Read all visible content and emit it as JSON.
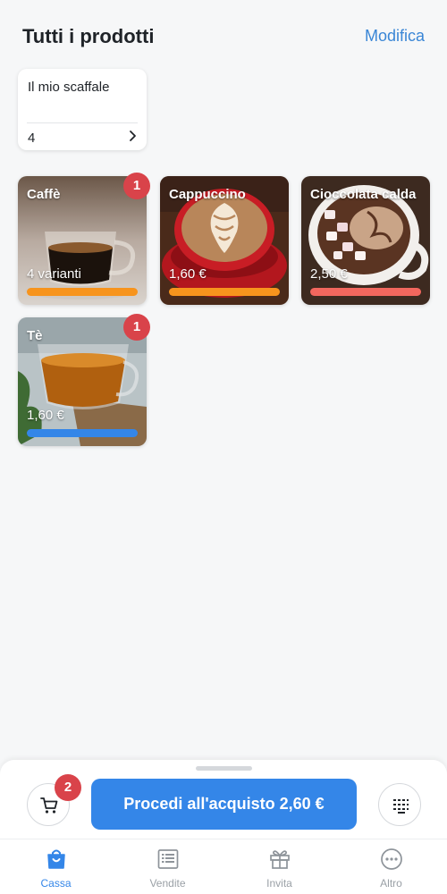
{
  "header": {
    "title": "Tutti i prodotti",
    "edit_label": "Modifica"
  },
  "shelf": {
    "name": "Il mio scaffale",
    "count": "4"
  },
  "products": [
    {
      "name": "Caffè",
      "subtitle": "4 varianti",
      "badge": "1",
      "bar_color": "#f7941d"
    },
    {
      "name": "Cappuccino",
      "subtitle": "1,60 €",
      "bar_color": "#f7941d"
    },
    {
      "name": "Cioccolata calda",
      "subtitle": "2,50 €",
      "bar_color": "#f2675e"
    },
    {
      "name": "Tè",
      "subtitle": "1,60 €",
      "badge": "1",
      "bar_color": "#3486e8"
    }
  ],
  "checkout": {
    "cart_count": "2",
    "button_label": "Procedi all'acquisto 2,60 €"
  },
  "tabs": [
    {
      "label": "Cassa",
      "icon": "shopping-bag-icon",
      "active": true
    },
    {
      "label": "Vendite",
      "icon": "receipt-list-icon",
      "active": false
    },
    {
      "label": "Invita",
      "icon": "gift-icon",
      "active": false
    },
    {
      "label": "Altro",
      "icon": "more-dots-icon",
      "active": false
    }
  ],
  "colors": {
    "accent": "#3486e8",
    "badge": "#d9434a",
    "link": "#3a86d6"
  }
}
